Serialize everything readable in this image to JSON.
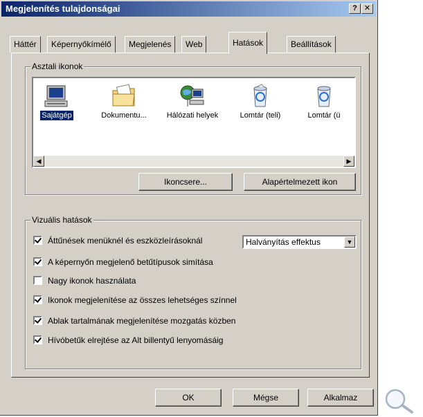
{
  "window": {
    "title": "Megjelenítés tulajdonságai",
    "help_label": "?",
    "close_label": "✕"
  },
  "tabs": [
    {
      "label": "Háttér"
    },
    {
      "label": "Képernyőkímélő"
    },
    {
      "label": "Megjelenés"
    },
    {
      "label": "Web"
    },
    {
      "label": "Hatások",
      "active": true
    },
    {
      "label": "Beállítások"
    }
  ],
  "desktop_icons": {
    "group_label": "Asztali ikonok",
    "items": [
      {
        "label": "Sajátgép",
        "icon": "computer-icon",
        "selected": true
      },
      {
        "label": "Dokumentu...",
        "icon": "folder-documents-icon"
      },
      {
        "label": "Hálózati helyek",
        "icon": "network-places-icon"
      },
      {
        "label": "Lomtár (teli)",
        "icon": "recycle-bin-full-icon"
      },
      {
        "label": "Lomtár (ü",
        "icon": "recycle-bin-empty-icon"
      }
    ],
    "change_icon_button": "Ikoncsere...",
    "default_icon_button": "Alapértelmezett ikon"
  },
  "visual_effects": {
    "group_label": "Vizuális hatások",
    "transition_effect_value": "Halványítás effektus",
    "options": [
      {
        "label": "Áttűnések menüknél és eszközleírásoknál",
        "checked": true
      },
      {
        "label": "A képernyőn megjelenő betűtípusok simítása",
        "checked": true
      },
      {
        "label": "Nagy ikonok használata",
        "checked": false
      },
      {
        "label": "Ikonok megjelenítése az összes lehetséges színnel",
        "checked": true
      },
      {
        "label": "Ablak tartalmának megjelenítése mozgatás közben",
        "checked": true
      },
      {
        "label": "Hívóbetűk elrejtése az Alt billentyű lenyomásáig",
        "checked": true
      }
    ]
  },
  "buttons": {
    "ok": "OK",
    "cancel": "Mégse",
    "apply": "Alkalmaz"
  },
  "colors": {
    "titlebar_start": "#0a246a",
    "titlebar_end": "#a6caf0",
    "face": "#d4d0c8",
    "selection": "#0a246a"
  }
}
